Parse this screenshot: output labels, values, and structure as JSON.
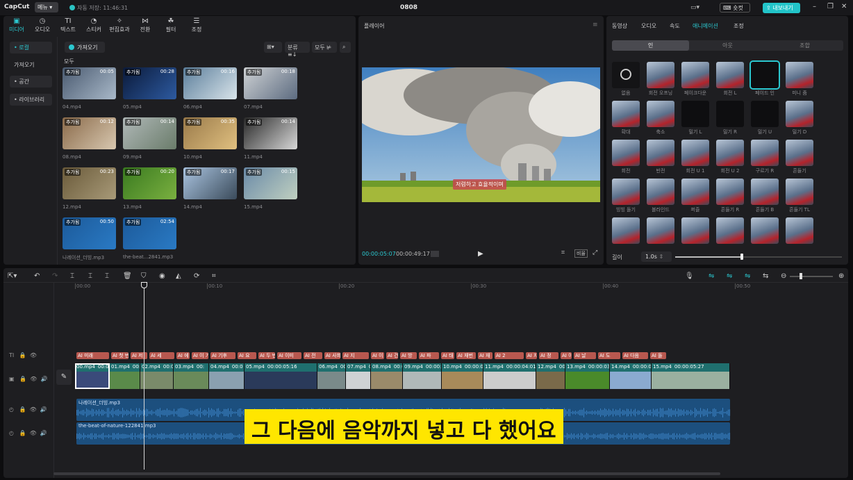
{
  "titlebar": {
    "app_name": "CapCut",
    "menu_label": "메뉴",
    "autosave": "자동 저장: 11:46:31",
    "project_title": "0808",
    "shortcut_label": "숏컷",
    "export_label": "내보내기"
  },
  "media_tabs": [
    {
      "icon": "▣",
      "label": "미디어"
    },
    {
      "icon": "◷",
      "label": "오디오"
    },
    {
      "icon": "TI",
      "label": "텍스트"
    },
    {
      "icon": "◔",
      "label": "스티커"
    },
    {
      "icon": "✧",
      "label": "편집효과"
    },
    {
      "icon": "⋈",
      "label": "전환"
    },
    {
      "icon": "☘",
      "label": "필터"
    },
    {
      "icon": "☰",
      "label": "조정"
    }
  ],
  "media_sidebar": [
    "• 로컬",
    "가져오기",
    "• 공간",
    "• 라이브러리"
  ],
  "media_toolbar": {
    "import": "가져오기",
    "sort": "분류 ≡↓",
    "all": "모두 ⊭",
    "section_label": "모두"
  },
  "media_items": [
    {
      "name": "04.mp4",
      "badge": "추가됨",
      "dur": "00:05",
      "colors": [
        "#4a5a70",
        "#a9b9c9"
      ]
    },
    {
      "name": "05.mp4",
      "badge": "추가됨",
      "dur": "00:28",
      "colors": [
        "#0b1a3a",
        "#2d5aa0"
      ]
    },
    {
      "name": "06.mp4",
      "badge": "추가됨",
      "dur": "00:16",
      "colors": [
        "#5c7f9c",
        "#d9e4ea"
      ]
    },
    {
      "name": "07.mp4",
      "badge": "추가됨",
      "dur": "00:18",
      "colors": [
        "#cfd2d4",
        "#5c6b80"
      ]
    },
    {
      "name": "08.mp4",
      "badge": "추가됨",
      "dur": "00:12",
      "colors": [
        "#8a6a4a",
        "#d8c8b0"
      ]
    },
    {
      "name": "09.mp4",
      "badge": "추가됨",
      "dur": "00:14",
      "colors": [
        "#b0b8b8",
        "#6a7c6a"
      ]
    },
    {
      "name": "10.mp4",
      "badge": "추가됨",
      "dur": "00:35",
      "colors": [
        "#9a7a4a",
        "#e0c080"
      ]
    },
    {
      "name": "11.mp4",
      "badge": "추가됨",
      "dur": "00:14",
      "colors": [
        "#2a2a2a",
        "#d8d8d8"
      ]
    },
    {
      "name": "12.mp4",
      "badge": "추가됨",
      "dur": "00:23",
      "colors": [
        "#6a5a3a",
        "#a89a78"
      ]
    },
    {
      "name": "13.mp4",
      "badge": "추가됨",
      "dur": "00:20",
      "colors": [
        "#3a7a20",
        "#7ab040"
      ]
    },
    {
      "name": "14.mp4",
      "badge": "추가됨",
      "dur": "00:17",
      "colors": [
        "#aac4e0",
        "#3a4a5a"
      ]
    },
    {
      "name": "15.mp4",
      "badge": "추가됨",
      "dur": "00:15",
      "colors": [
        "#6a8aa8",
        "#c0d0c0"
      ]
    },
    {
      "name": "나레이션_더빙.mp3",
      "badge": "추가됨",
      "dur": "00:50",
      "colors": [
        "#1c5a9a",
        "#2a7ac4"
      ]
    },
    {
      "name": "the-beat...2841.mp3",
      "badge": "추가됨",
      "dur": "02:54",
      "colors": [
        "#1c5a9a",
        "#2a7ac4"
      ]
    }
  ],
  "player": {
    "title": "플레이어",
    "caption": "저렴하고 효율적이며",
    "current_time": "00:00:05:07",
    "total_time": "00:00:49:17",
    "ratio_label": "비율"
  },
  "details": {
    "tabs": [
      "동영상",
      "오디오",
      "속도",
      "애니메이션",
      "조정"
    ],
    "active_tab": "애니메이션",
    "segments": [
      "인",
      "아웃",
      "조합"
    ],
    "animations": [
      "없음",
      "회전 오프닝",
      "페이크다운",
      "회전 L",
      "페이드 인",
      "미니 줌",
      "확대",
      "축소",
      "밀기 L",
      "밀기 R",
      "밀기 U",
      "밀기 D",
      "회전",
      "반전",
      "회전 U 1",
      "회전 U 2",
      "구르기 R",
      "흔들기",
      "빙빙 돌기",
      "블라인드",
      "퍼즐",
      "흔들기 R",
      "흔들기 B",
      "흔들기 TL",
      "",
      "",
      "",
      "",
      "",
      ""
    ],
    "length_label": "길이",
    "length_value": "1.0s"
  },
  "timeline": {
    "ruler": [
      "00:00",
      "00:10",
      "00:20",
      "00:30",
      "00:40",
      "00:50"
    ],
    "text_chips": [
      "AI 미래",
      "AI 첫 번째",
      "AI 저",
      "AI 세",
      "AI 에",
      "AI 이 기",
      "AI 기후",
      "AI 요",
      "AI 두 번",
      "AI 이미",
      "AI 전",
      "AI 사회",
      "AI 지",
      "AI 이",
      "AI 건",
      "AI 방",
      "AI 파",
      "AI 태",
      "AI 재번",
      "AI 재",
      "AI 2",
      "AI 지속적",
      "AI 정",
      "AI 이 항",
      "AI 날",
      "AI 도",
      "AI 다음",
      "AI 돌"
    ],
    "video_clips": [
      {
        "label": "00.mp4",
        "dur": "00:0"
      },
      {
        "label": "01.mp4",
        "dur": "00:"
      },
      {
        "label": "02.mp4",
        "dur": "00:0"
      },
      {
        "label": "03.mp4",
        "dur": "00:"
      },
      {
        "label": "04.mp4",
        "dur": "00:0"
      },
      {
        "label": "05.mp4",
        "dur": "00:00:05:16"
      },
      {
        "label": "06.mp4",
        "dur": "00:0"
      },
      {
        "label": "07.mp4",
        "dur": "00"
      },
      {
        "label": "08.mp4",
        "dur": "00:0"
      },
      {
        "label": "09.mp4",
        "dur": "00:00:0"
      },
      {
        "label": "10.mp4",
        "dur": "00:00:03"
      },
      {
        "label": "11.mp4",
        "dur": "00:00:04:01"
      },
      {
        "label": "12.mp4",
        "dur": "00:0"
      },
      {
        "label": "13.mp4",
        "dur": "00:00:03"
      },
      {
        "label": "14.mp4",
        "dur": "00:00:0"
      },
      {
        "label": "15.mp4",
        "dur": "00:00:05:27"
      }
    ],
    "audio_tracks": [
      "나레이션_더빙.mp3",
      "the-beat-of-nature-122841.mp3"
    ],
    "subtitle": "그 다음에 음악까지 넣고 다 했어요"
  }
}
